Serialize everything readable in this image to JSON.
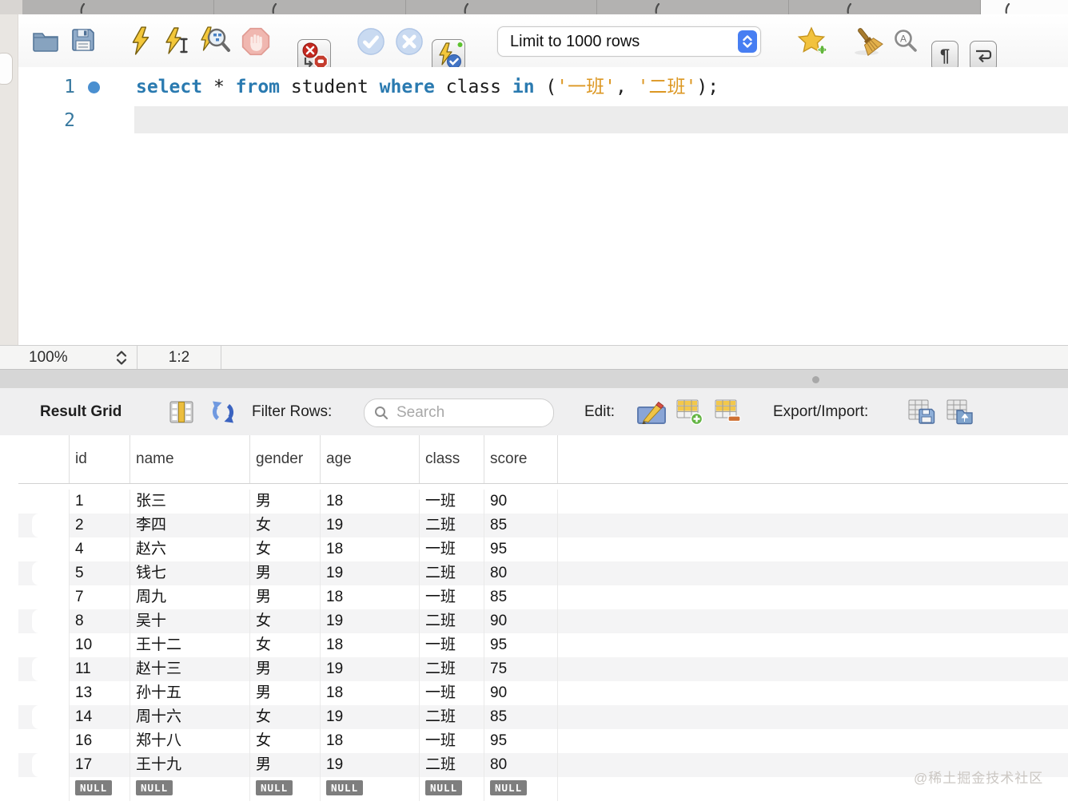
{
  "tabs": {
    "count": 6,
    "active_index": 5
  },
  "toolbar": {
    "limit_dropdown_value": "Limit to 1000 rows",
    "show_invisibles_glyph": "¶",
    "icons": [
      "open-script",
      "save-script",
      "execute-statement",
      "execute-current-statement",
      "explain-plan",
      "stop-execution",
      "toggle-stop-on-error",
      "commit",
      "rollback",
      "toggle-autocommit",
      "save-snippet",
      "beautify-script",
      "find-panel",
      "show-invisibles",
      "toggle-word-wrap"
    ]
  },
  "editor": {
    "lines": [
      {
        "number": "1",
        "marker": true,
        "current": false,
        "tokens": [
          [
            "kw",
            "select"
          ],
          [
            "pl",
            " * "
          ],
          [
            "kw",
            "from"
          ],
          [
            "pl",
            " student "
          ],
          [
            "kw",
            "where"
          ],
          [
            "pl",
            " class "
          ],
          [
            "kw",
            "in"
          ],
          [
            "pl",
            " ("
          ],
          [
            "str",
            "'一班'"
          ],
          [
            "pl",
            ", "
          ],
          [
            "str",
            "'二班'"
          ],
          [
            "pl",
            ");"
          ]
        ]
      },
      {
        "number": "2",
        "marker": false,
        "current": true,
        "tokens": []
      }
    ]
  },
  "status_bar": {
    "zoom_level": "100%",
    "cursor_position": "1:2"
  },
  "result_toolbar": {
    "title": "Result Grid",
    "filter_label": "Filter Rows:",
    "search_placeholder": "Search",
    "edit_label": "Edit:",
    "export_import_label": "Export/Import:",
    "icons": [
      "result-grid-view",
      "refresh",
      "search",
      "edit-record",
      "insert-row",
      "delete-row",
      "export-recordset",
      "import-records"
    ]
  },
  "result_grid": {
    "columns": [
      "id",
      "name",
      "gender",
      "age",
      "class",
      "score"
    ],
    "rows": [
      [
        "1",
        "张三",
        "男",
        "18",
        "一班",
        "90"
      ],
      [
        "2",
        "李四",
        "女",
        "19",
        "二班",
        "85"
      ],
      [
        "4",
        "赵六",
        "女",
        "18",
        "一班",
        "95"
      ],
      [
        "5",
        "钱七",
        "男",
        "19",
        "二班",
        "80"
      ],
      [
        "7",
        "周九",
        "男",
        "18",
        "一班",
        "85"
      ],
      [
        "8",
        "吴十",
        "女",
        "19",
        "二班",
        "90"
      ],
      [
        "10",
        "王十二",
        "女",
        "18",
        "一班",
        "95"
      ],
      [
        "11",
        "赵十三",
        "男",
        "19",
        "二班",
        "75"
      ],
      [
        "13",
        "孙十五",
        "男",
        "18",
        "一班",
        "90"
      ],
      [
        "14",
        "周十六",
        "女",
        "19",
        "二班",
        "85"
      ],
      [
        "16",
        "郑十八",
        "女",
        "18",
        "一班",
        "95"
      ],
      [
        "17",
        "王十九",
        "男",
        "19",
        "二班",
        "80"
      ]
    ],
    "null_row": [
      "NULL",
      "NULL",
      "NULL",
      "NULL",
      "NULL",
      "NULL"
    ]
  },
  "watermark": "@稀土掘金技术社区",
  "colors": {
    "keyword": "#2a7ab0",
    "string": "#dc9722",
    "plain": "#1c1c1c",
    "line_number": "#36789f",
    "stripe": "#f4f4f5",
    "null_badge": "#7e7e7e",
    "dropdown_stepper": "#477ef2",
    "current_line": "#ececec"
  }
}
